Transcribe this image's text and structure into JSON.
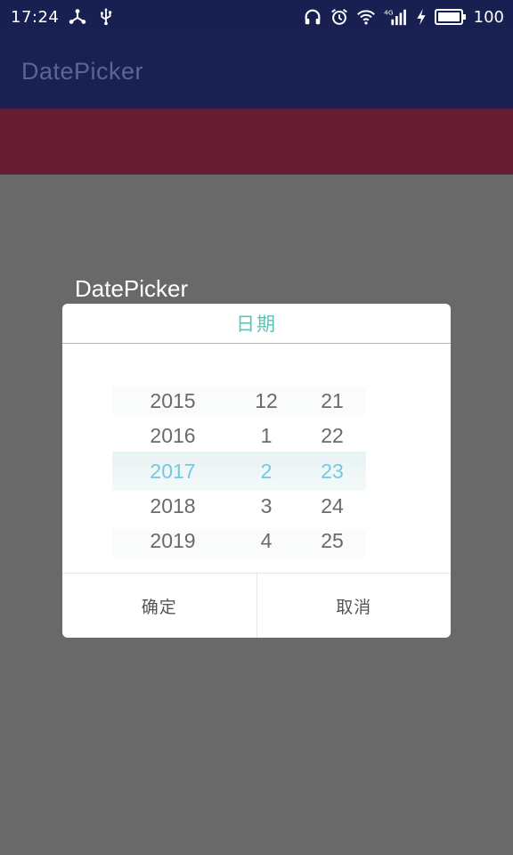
{
  "status_bar": {
    "time": "17:24",
    "left_icons": [
      "network-share-icon",
      "usb-icon"
    ],
    "right_icons": [
      "headphones-icon",
      "alarm-icon",
      "wifi-icon",
      "4g-signal-icon",
      "charging-icon",
      "battery-icon"
    ],
    "signal_label": "4G",
    "battery_percent": "100"
  },
  "app_bar": {
    "title": "DatePicker"
  },
  "dialog_label": "DatePicker",
  "dialog": {
    "title": "日期",
    "years": [
      "2015",
      "2016",
      "2017",
      "2018",
      "2019"
    ],
    "months": [
      "12",
      "1",
      "2",
      "3",
      "4"
    ],
    "days": [
      "21",
      "22",
      "23",
      "24",
      "25"
    ],
    "selected_index": 2,
    "confirm_label": "确定",
    "cancel_label": "取消"
  },
  "colors": {
    "status_bar": "#182051",
    "app_bar": "#1a2152",
    "accent_bar": "#661c33",
    "overlay": "#696969",
    "title_accent": "#5ec2b5",
    "selected_text": "#76c7e0"
  }
}
